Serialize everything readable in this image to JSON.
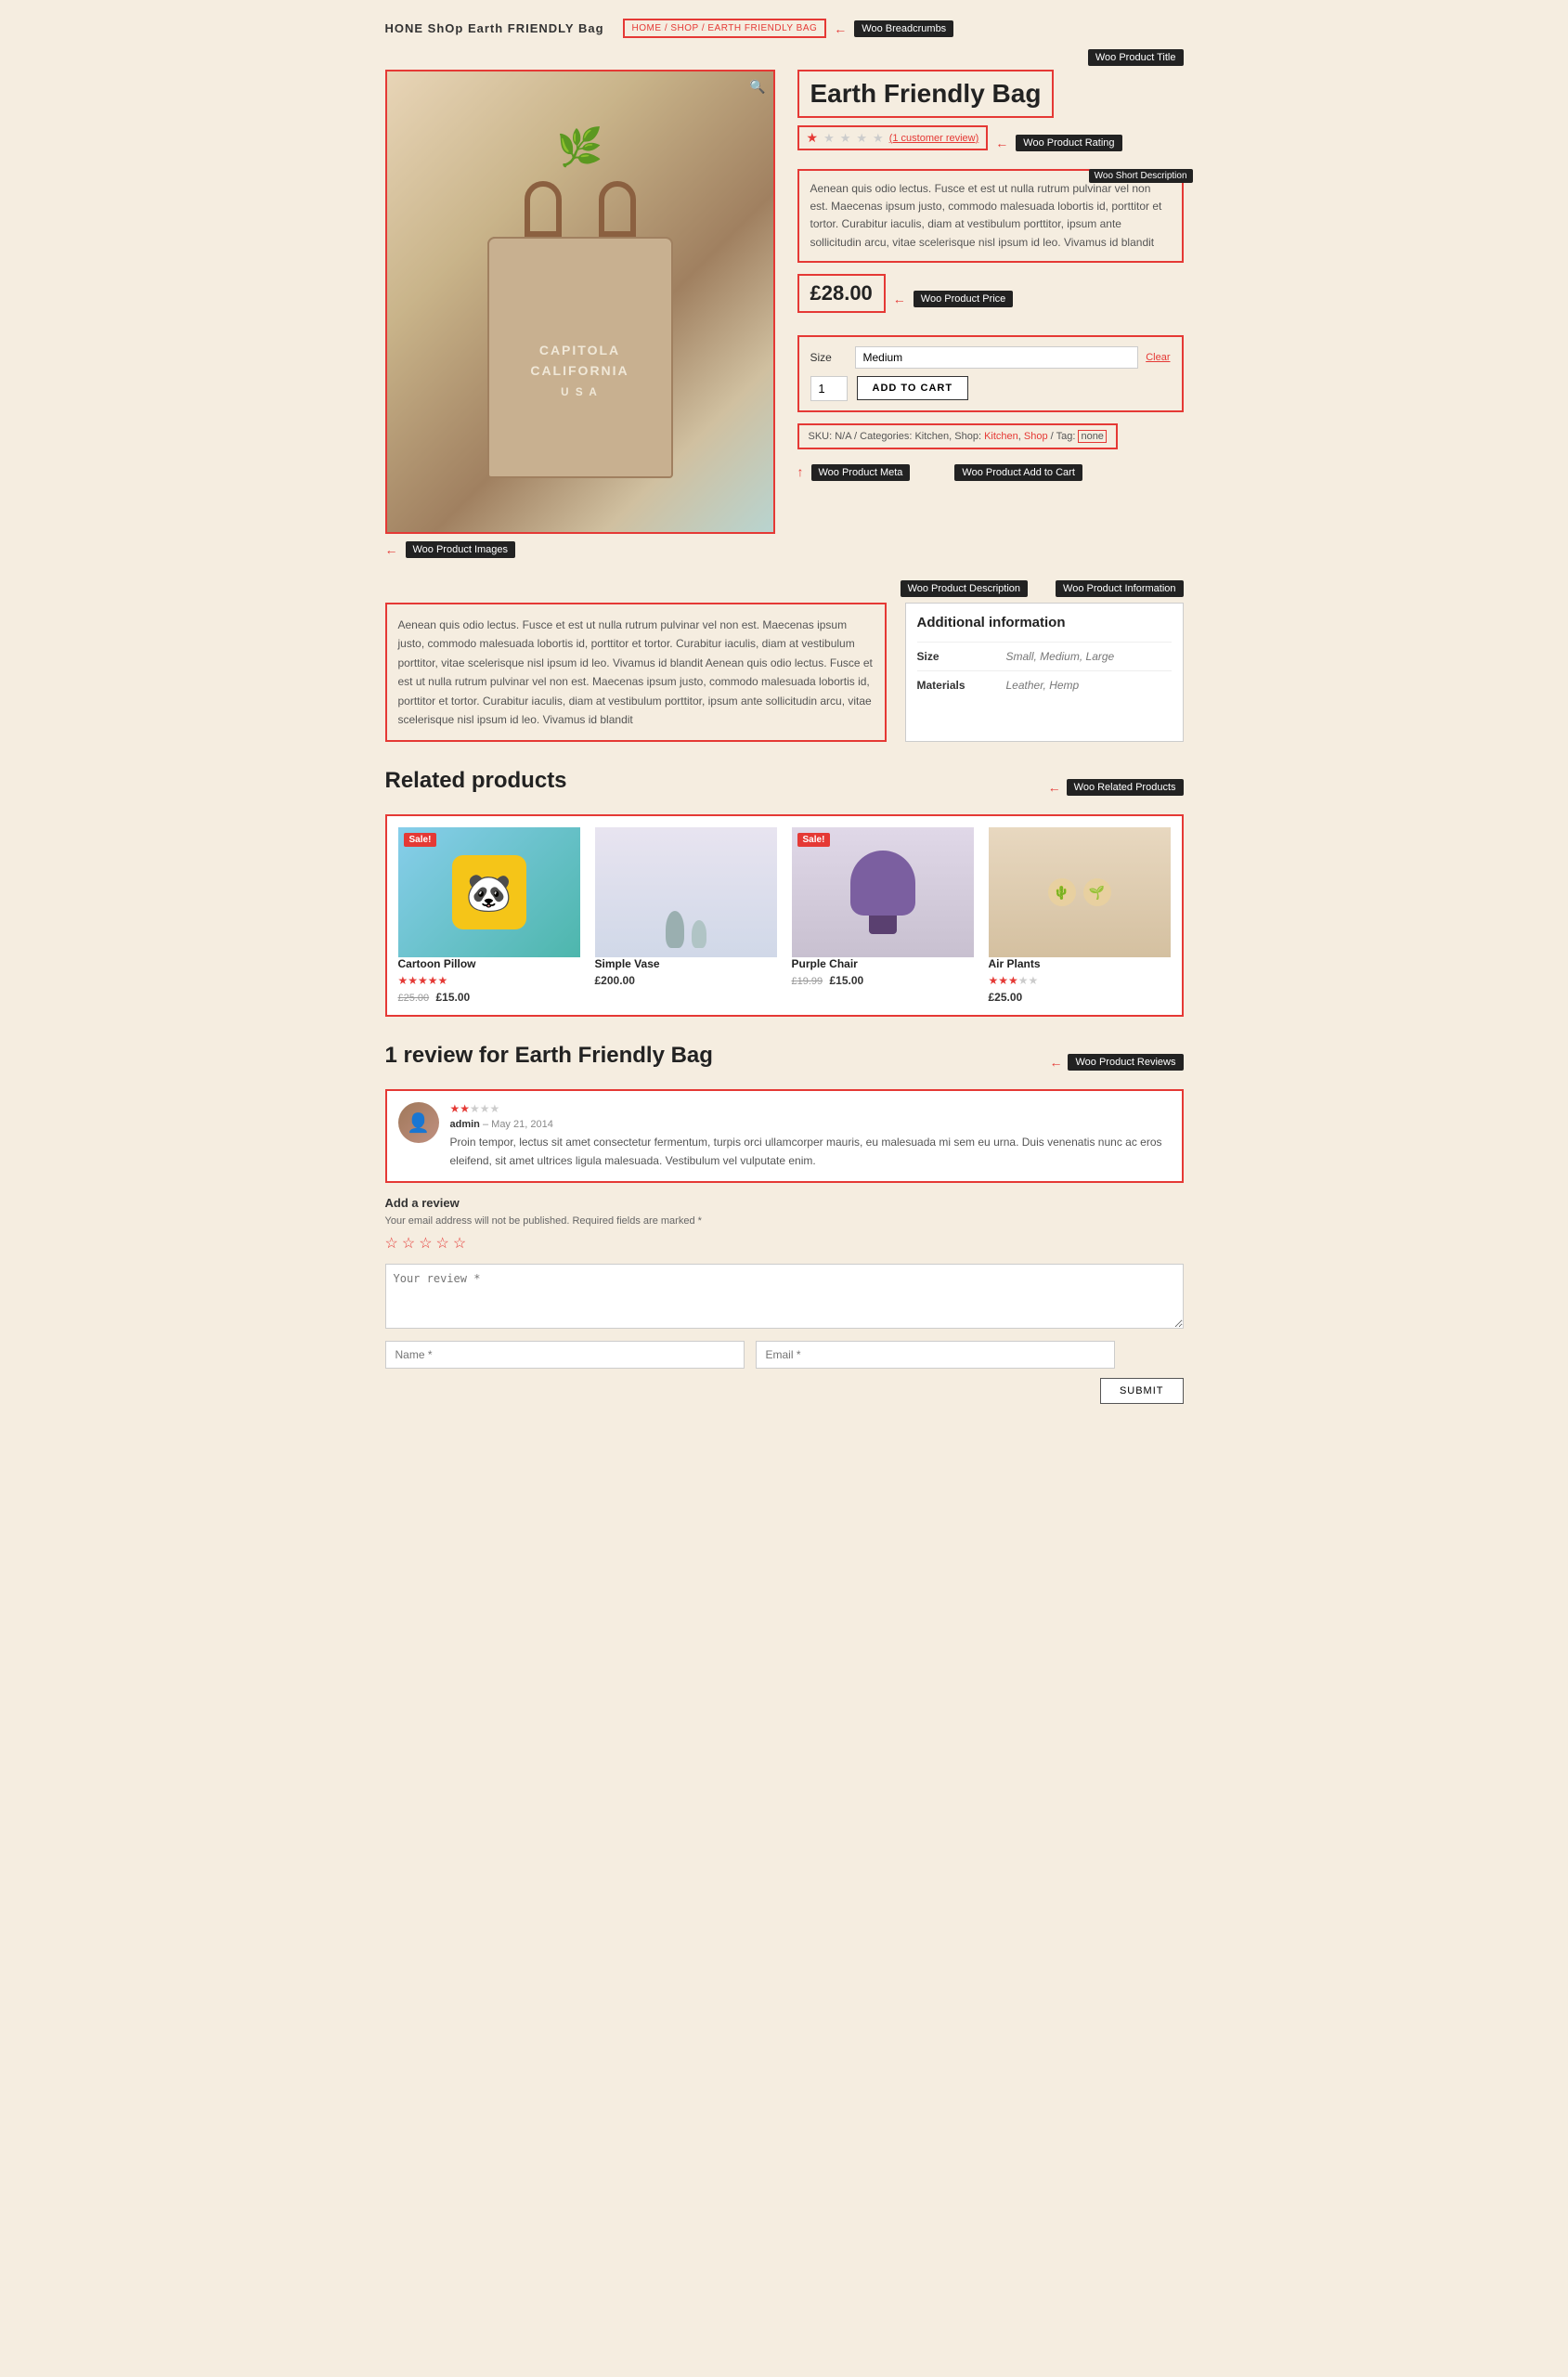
{
  "site": {
    "name": "HONE ShOp Earth FRIENDLY Bag",
    "breadcrumbs_text": "HOME / SHOP / EARTH FRIENDLY BAG"
  },
  "annotations": {
    "breadcrumbs": "Woo Breadcrumbs",
    "product_title": "Woo Product Title",
    "short_description": "Woo Short\nDescription",
    "product_rating": "Woo Product Rating",
    "product_price": "Woo Product Price",
    "add_to_cart": "Woo Product\nAdd to Cart",
    "product_meta": "Woo Product Meta",
    "product_images": "Woo Product Images",
    "product_description": "Woo Product\nDescription",
    "product_information": "Woo Product Information",
    "related_products": "Woo Related Products",
    "product_reviews": "Woo Product Reviews"
  },
  "product": {
    "title": "Earth Friendly Bag",
    "rating_stars": 1,
    "rating_total": 5,
    "review_count": "(1 customer review)",
    "short_description": "Aenean quis odio lectus. Fusce et est ut nulla rutrum pulvinar vel non est. Maecenas ipsum justo, commodo malesuada lobortis id, porttitor et tortor. Curabitur iaculis, diam at vestibulum porttitor, ipsum ante sollicitudin arcu, vitae scelerisque nisl ipsum id leo. Vivamus id blandit",
    "price": "£28.00",
    "sku": "SKU: N/A",
    "categories": "Categories: Kitchen, Shop",
    "tag": "Tag:",
    "tag_value": "none",
    "size_options": [
      "Small",
      "Medium",
      "Large"
    ],
    "size_default": "Medium",
    "qty": "1",
    "add_to_cart_label": "ADD TO CART",
    "clear_label": "Clear",
    "description_text": "Aenean quis odio lectus. Fusce et est ut nulla rutrum pulvinar vel non est. Maecenas ipsum justo, commodo malesuada lobortis id, porttitor et tortor. Curabitur iaculis, diam at vestibulum porttitor, vitae scelerisque nisl ipsum id leo. Vivamus id blandit Aenean quis odio lectus. Fusce et est ut nulla rutrum pulvinar vel non est. Maecenas ipsum justo, commodo malesuada lobortis id, porttitor et tortor. Curabitur iaculis, diam at vestibulum porttitor, ipsum ante sollicitudin arcu, vitae scelerisque nisl ipsum id leo. Vivamus id blandit",
    "additional_info": {
      "title": "Additional information",
      "rows": [
        {
          "key": "Size",
          "value": "Small, Medium, Large"
        },
        {
          "key": "Materials",
          "value": "Leather, Hemp"
        }
      ]
    }
  },
  "related_products": {
    "title": "Related products",
    "items": [
      {
        "name": "Cartoon Pillow",
        "sale": true,
        "old_price": "£25.00",
        "price": "£15.00",
        "stars": 5,
        "type": "panda"
      },
      {
        "name": "Simple Vase",
        "sale": false,
        "price": "£200.00",
        "stars": 0,
        "type": "vase"
      },
      {
        "name": "Purple Chair",
        "sale": true,
        "old_price": "£19.99",
        "price": "£15.00",
        "stars": 0,
        "type": "chair"
      },
      {
        "name": "Air Plants",
        "sale": false,
        "price": "£25.00",
        "stars": 3,
        "type": "plants"
      }
    ]
  },
  "reviews": {
    "title": "1 review for Earth Friendly Bag",
    "items": [
      {
        "author": "admin",
        "date": "May 21, 2014",
        "stars": 2,
        "text": "Proin tempor, lectus sit amet consectetur fermentum, turpis orci ullamcorper mauris, eu malesuada mi sem eu urna. Duis venenatis nunc ac eros eleifend, sit amet ultrices ligula malesuada. Vestibulum vel vulputate enim."
      }
    ],
    "add_review_label": "Add a review",
    "required_note": "Your email address will not be published. Required fields are marked *",
    "your_review_label": "Your review *",
    "name_label": "Name *",
    "email_label": "Email *",
    "submit_label": "SUBMIT"
  }
}
